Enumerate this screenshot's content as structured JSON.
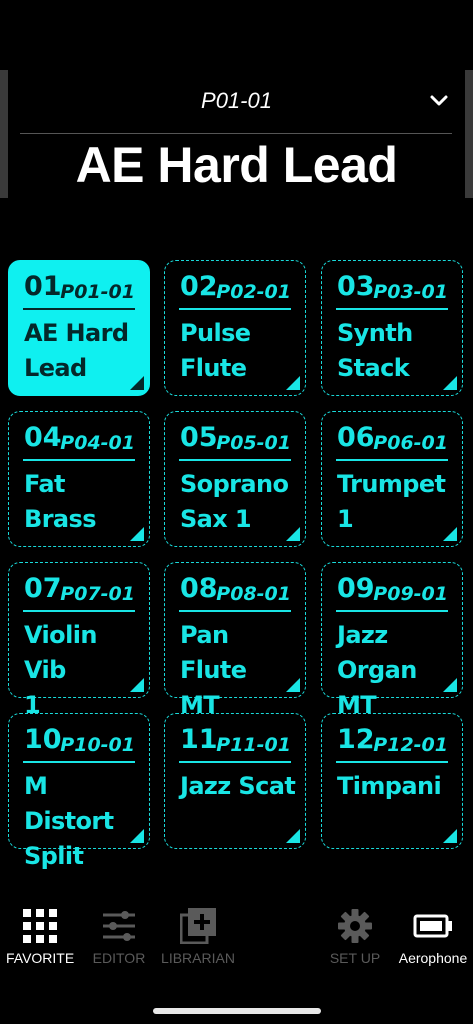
{
  "header": {
    "patch_number": "P01-01",
    "patch_name": "AE Hard Lead",
    "dropdown_icon": "chevron-down-icon"
  },
  "favorites": [
    {
      "slot": "01",
      "patch": "P01-01",
      "name_line1": "AE Hard",
      "name_line2": "Lead",
      "selected": true
    },
    {
      "slot": "02",
      "patch": "P02-01",
      "name_line1": "Pulse",
      "name_line2": "Flute",
      "selected": false
    },
    {
      "slot": "03",
      "patch": "P03-01",
      "name_line1": "Synth",
      "name_line2": "Stack",
      "selected": false
    },
    {
      "slot": "04",
      "patch": "P04-01",
      "name_line1": "Fat Brass",
      "name_line2": "",
      "selected": false
    },
    {
      "slot": "05",
      "patch": "P05-01",
      "name_line1": "Soprano",
      "name_line2": "Sax 1",
      "selected": false
    },
    {
      "slot": "06",
      "patch": "P06-01",
      "name_line1": "Trumpet",
      "name_line2": "1",
      "selected": false
    },
    {
      "slot": "07",
      "patch": "P07-01",
      "name_line1": "Violin Vib",
      "name_line2": "1",
      "selected": false
    },
    {
      "slot": "08",
      "patch": "P08-01",
      "name_line1": "Pan Flute",
      "name_line2": "MT",
      "selected": false
    },
    {
      "slot": "09",
      "patch": "P09-01",
      "name_line1": "Jazz",
      "name_line2": "Organ MT",
      "selected": false
    },
    {
      "slot": "10",
      "patch": "P10-01",
      "name_line1": "M Distort",
      "name_line2": "Split",
      "selected": false
    },
    {
      "slot": "11",
      "patch": "P11-01",
      "name_line1": "Jazz Scat",
      "name_line2": "",
      "selected": false
    },
    {
      "slot": "12",
      "patch": "P12-01",
      "name_line1": "Timpani",
      "name_line2": "",
      "selected": false
    }
  ],
  "nav": {
    "favorite": {
      "label": "FAVORITE",
      "icon": "grid-icon",
      "active": true
    },
    "editor": {
      "label": "EDITOR",
      "icon": "sliders-icon",
      "active": false
    },
    "librarian": {
      "label": "LIBRARIAN",
      "icon": "library-add-icon",
      "active": false
    },
    "setup": {
      "label": "SET UP",
      "icon": "gear-icon",
      "active": false
    },
    "device": {
      "label": "Aerophone",
      "icon": "battery-icon",
      "active": true
    }
  },
  "colors": {
    "accent": "#0ff0f0",
    "tile_border": "#19d9d9",
    "background": "#000000",
    "inactive_nav": "#5a5a5a"
  }
}
